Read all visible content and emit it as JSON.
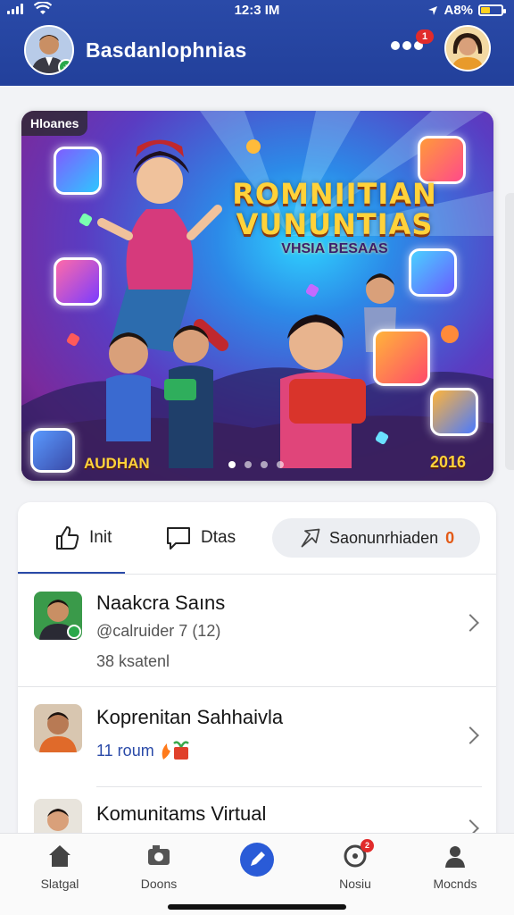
{
  "status_bar": {
    "time": "12:3 IM",
    "battery": "A8%"
  },
  "header": {
    "title": "Basdanlophnias",
    "notification_count": "1"
  },
  "banner": {
    "tag": "Hloanes",
    "title_line1": "ROMNIITIAN",
    "title_line2": "VUNUNTIAS",
    "subtitle": "VHSIA BESAAS",
    "left_label": "AUDHAN",
    "right_label": "2016",
    "slide_count": 4,
    "active_slide": 1
  },
  "actions": {
    "like_label": "Init",
    "comment_label": "Dtas",
    "share_label": "Saonunrhiaden",
    "share_count": "0"
  },
  "list": [
    {
      "title": "Naakcra Saıns",
      "subtitle": "@calruider 7 (12)",
      "meta": "38 ksatenl"
    },
    {
      "title": "Koprenitan Sahhaivla",
      "subtitle": "11 roum",
      "meta": ""
    },
    {
      "title": "Komunitams Virtual",
      "subtitle": "",
      "meta": ""
    }
  ],
  "bottom_nav": [
    {
      "label": "Slatgal",
      "icon": "home-icon"
    },
    {
      "label": "Doons",
      "icon": "camera-icon"
    },
    {
      "label": "",
      "icon": "compose-icon"
    },
    {
      "label": "Nosiu",
      "icon": "bell-icon",
      "badge": "2"
    },
    {
      "label": "Mocnds",
      "icon": "person-icon"
    }
  ],
  "colors": {
    "brand": "#2a4aa8",
    "accent": "#2a5bd7",
    "badge": "#e12b2b",
    "banner_text": "#ffd23a"
  }
}
